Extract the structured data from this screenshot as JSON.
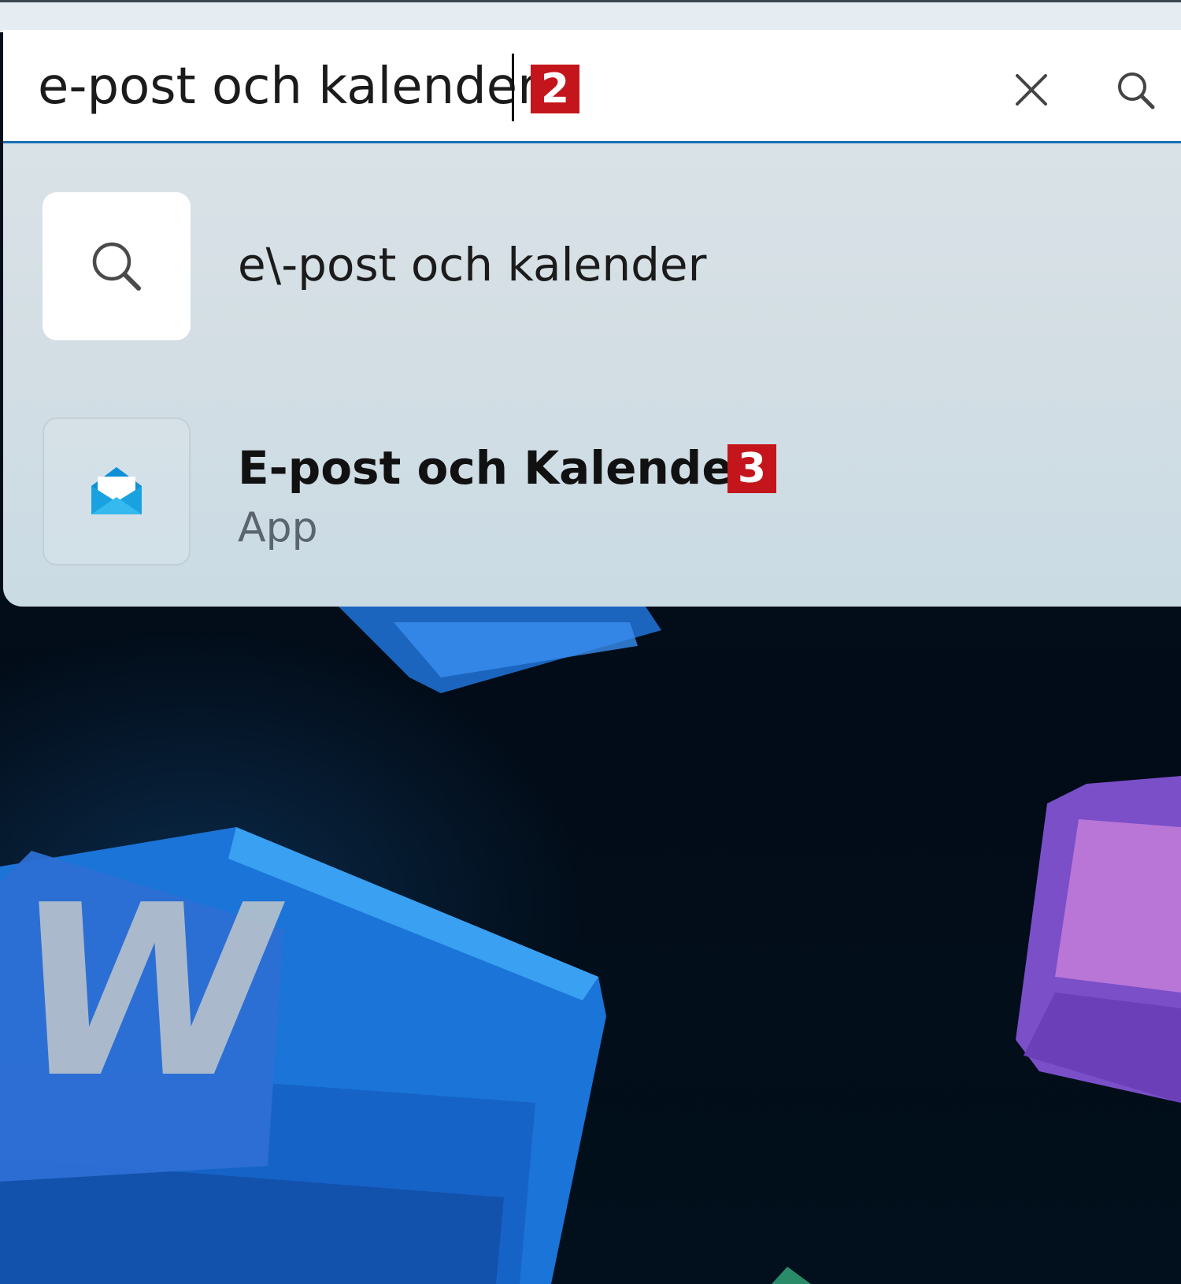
{
  "search": {
    "query": "e-post och kalender",
    "step_badge": "2",
    "clear_icon": "close-icon",
    "search_icon": "search-icon"
  },
  "results": [
    {
      "icon": "search-icon",
      "label": "e\\-post och kalender"
    },
    {
      "icon": "mail-app-icon",
      "title": "E-post och Kalender",
      "subtitle": "App",
      "step_badge": "3"
    }
  ],
  "colors": {
    "badge": "#c4151c",
    "accent": "#1b6fb5",
    "mail_icon": "#1aa2e0"
  },
  "wallpaper": {
    "word_letter": "W"
  }
}
